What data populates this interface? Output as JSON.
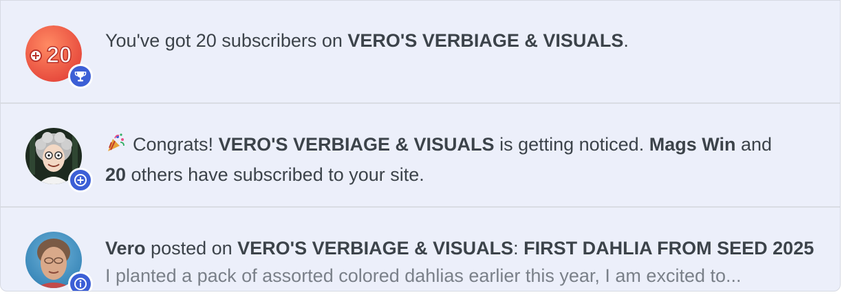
{
  "notifications": [
    {
      "type": "achievement",
      "avatar_label": "+20",
      "badge_icon": "trophy-icon",
      "parts": [
        "You've got 20 subscribers on ",
        "VERO'S VERBIAGE & VISUALS",
        "."
      ]
    },
    {
      "type": "subscribe",
      "badge_icon": "plus-icon",
      "emoji": "🎉",
      "parts": [
        "Congrats! ",
        "VERO'S VERBIAGE & VISUALS",
        " is getting noticed. ",
        "Mags Win",
        " and",
        "20",
        " others have subscribed to your site."
      ]
    },
    {
      "type": "post",
      "badge_icon": "info-icon",
      "parts": [
        "Vero",
        " posted on ",
        "VERO'S VERBIAGE & VISUALS",
        ": ",
        "FIRST DAHLIA FROM SEED 2025"
      ],
      "excerpt": "I planted a pack of assorted colored dahlias earlier this year, I am excited to..."
    }
  ],
  "colors": {
    "panel_bg": "#eceffa",
    "badge_bg": "#3c5fd6",
    "text": "#3c434a",
    "excerpt": "#7a8089"
  }
}
